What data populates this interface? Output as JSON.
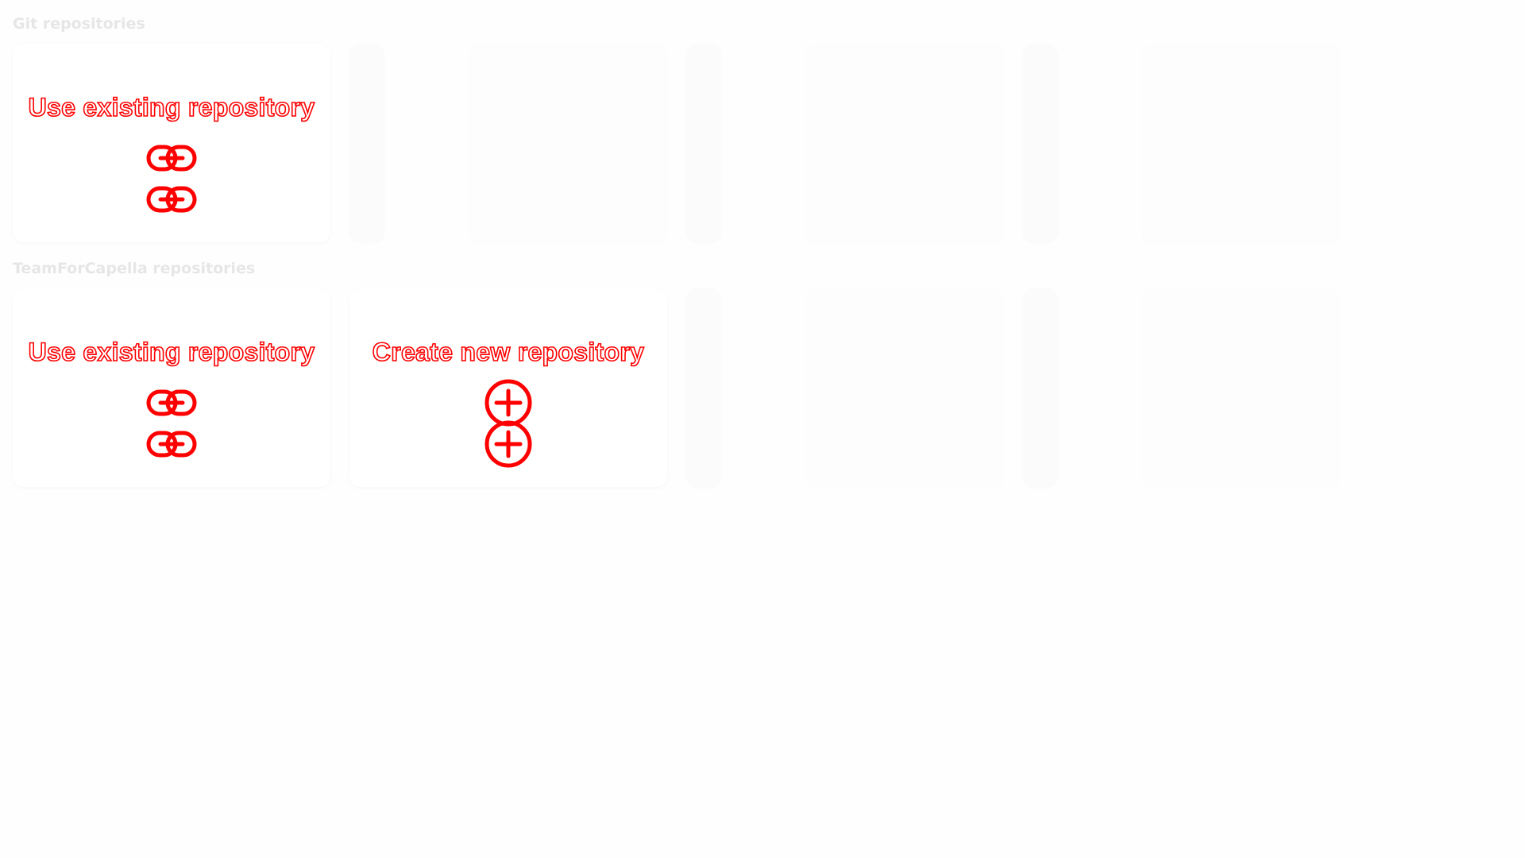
{
  "sections": [
    {
      "title": "Git repositories",
      "tiles": [
        {
          "label": "Use existing repository",
          "icon": "link-icon"
        }
      ]
    },
    {
      "title": "TeamForCapella repositories",
      "tiles": [
        {
          "label": "Use existing repository",
          "icon": "link-icon"
        },
        {
          "label": "Create new repository",
          "icon": "add-circle-icon"
        }
      ]
    }
  ],
  "colors": {
    "accent": "#ff0000",
    "section_title": "#e6e6e6",
    "tile_background": "#ffffff",
    "page_background": "#fefefe"
  }
}
